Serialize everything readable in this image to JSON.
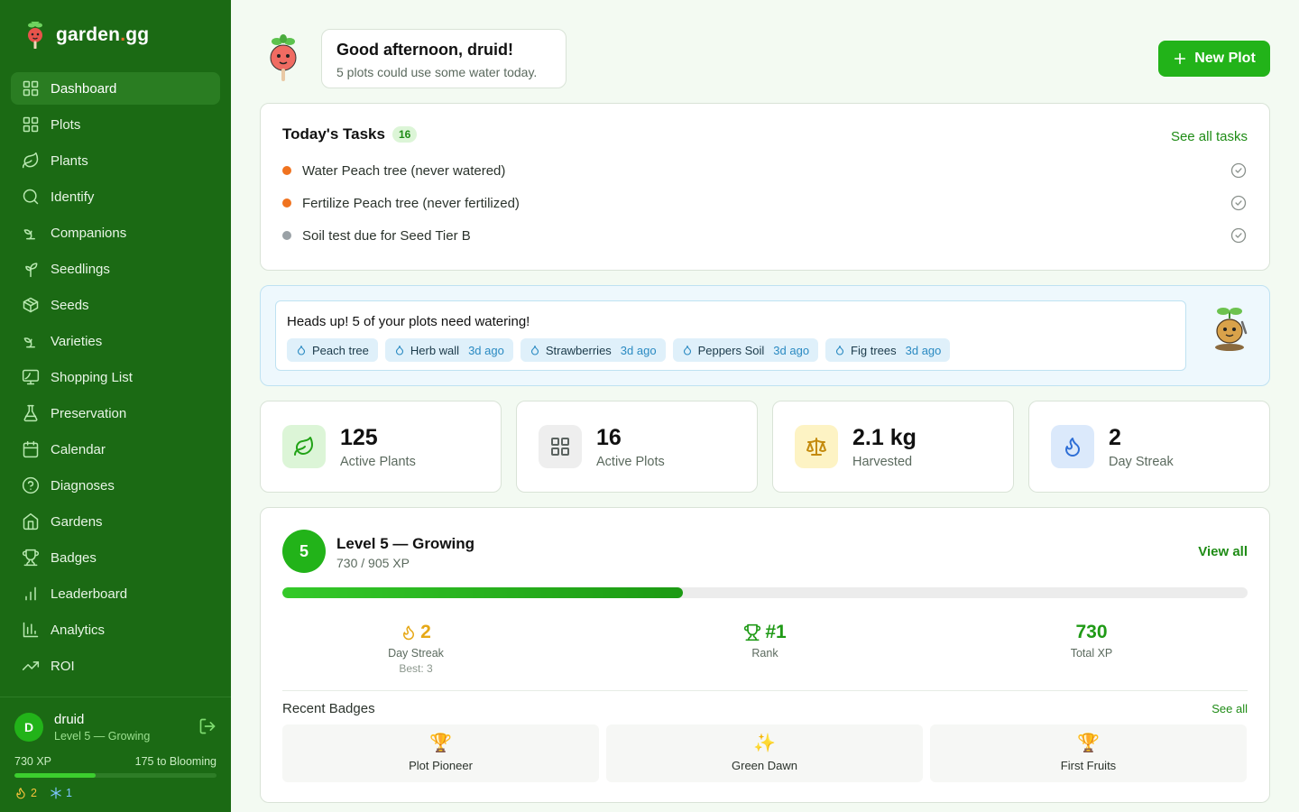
{
  "brand": {
    "name_main": "garden",
    "name_dot": ".",
    "name_tail": "gg"
  },
  "nav": [
    {
      "label": "Dashboard",
      "icon": "grid-icon",
      "active": true
    },
    {
      "label": "Plots",
      "icon": "grid-icon"
    },
    {
      "label": "Plants",
      "icon": "leaf-icon"
    },
    {
      "label": "Identify",
      "icon": "search-icon"
    },
    {
      "label": "Companions",
      "icon": "sprout-icon"
    },
    {
      "label": "Seedlings",
      "icon": "seedling-icon"
    },
    {
      "label": "Seeds",
      "icon": "package-icon"
    },
    {
      "label": "Varieties",
      "icon": "sprout-icon"
    },
    {
      "label": "Shopping List",
      "icon": "monitor-icon"
    },
    {
      "label": "Preservation",
      "icon": "flask-icon"
    },
    {
      "label": "Calendar",
      "icon": "calendar-icon"
    },
    {
      "label": "Diagnoses",
      "icon": "help-circle-icon"
    },
    {
      "label": "Gardens",
      "icon": "home-icon"
    },
    {
      "label": "Badges",
      "icon": "trophy-icon"
    },
    {
      "label": "Leaderboard",
      "icon": "bar-chart-icon"
    },
    {
      "label": "Analytics",
      "icon": "bar-chart-2-icon"
    },
    {
      "label": "ROI",
      "icon": "trending-up-icon"
    }
  ],
  "user": {
    "initial": "D",
    "name": "druid",
    "level": "Level 5 — Growing",
    "xp": "730 XP",
    "to_next": "175 to Blooming",
    "progress": 0.4,
    "streak": "2",
    "freeze": "1"
  },
  "greeting": {
    "title": "Good afternoon, druid!",
    "subtitle": "5 plots could use some water today."
  },
  "new_plot": "New Plot",
  "tasks": {
    "title": "Today's Tasks",
    "count": "16",
    "see_all": "See all tasks",
    "items": [
      {
        "text": "Water Peach tree (never watered)",
        "color": "#f0731f"
      },
      {
        "text": "Fertilize Peach tree (never fertilized)",
        "color": "#f0731f"
      },
      {
        "text": "Soil test due for Seed Tier B",
        "color": "#9aa1a6"
      }
    ]
  },
  "alert": {
    "message": "Heads up! 5 of your plots need watering!",
    "chips": [
      {
        "name": "Peach tree",
        "ago": ""
      },
      {
        "name": "Herb wall",
        "ago": "3d ago"
      },
      {
        "name": "Strawberries",
        "ago": "3d ago"
      },
      {
        "name": "Peppers Soil",
        "ago": "3d ago"
      },
      {
        "name": "Fig trees",
        "ago": "3d ago"
      }
    ]
  },
  "stats": [
    {
      "value": "125",
      "label": "Active Plants",
      "icon": "leaf-icon",
      "bg": "#dcf5d7",
      "fg": "#22a317"
    },
    {
      "value": "16",
      "label": "Active Plots",
      "icon": "grid-icon",
      "bg": "#eeeeee",
      "fg": "#5b6360"
    },
    {
      "value": "2.1 kg",
      "label": "Harvested",
      "icon": "scale-icon",
      "bg": "#fdf3c4",
      "fg": "#c48a0c"
    },
    {
      "value": "2",
      "label": "Day Streak",
      "icon": "flame-icon",
      "bg": "#dbe9fb",
      "fg": "#2f6fd6"
    }
  ],
  "level": {
    "number": "5",
    "title": "Level 5 — Growing",
    "xp": "730 / 905 XP",
    "view_all": "View all",
    "progress": 0.415,
    "streak_value": "2",
    "streak_label": "Day Streak",
    "streak_best": "Best: 3",
    "rank_value": "#1",
    "rank_label": "Rank",
    "total_value": "730",
    "total_label": "Total XP",
    "recent_badges_title": "Recent Badges",
    "see_all": "See all",
    "badges": [
      {
        "icon": "🏆",
        "name": "Plot Pioneer"
      },
      {
        "icon": "✨",
        "name": "Green Dawn"
      },
      {
        "icon": "🏆",
        "name": "First Fruits"
      }
    ]
  },
  "colors": {
    "sidebar": "#1b6a14",
    "accent": "#22b319",
    "link": "#1f8c16"
  }
}
